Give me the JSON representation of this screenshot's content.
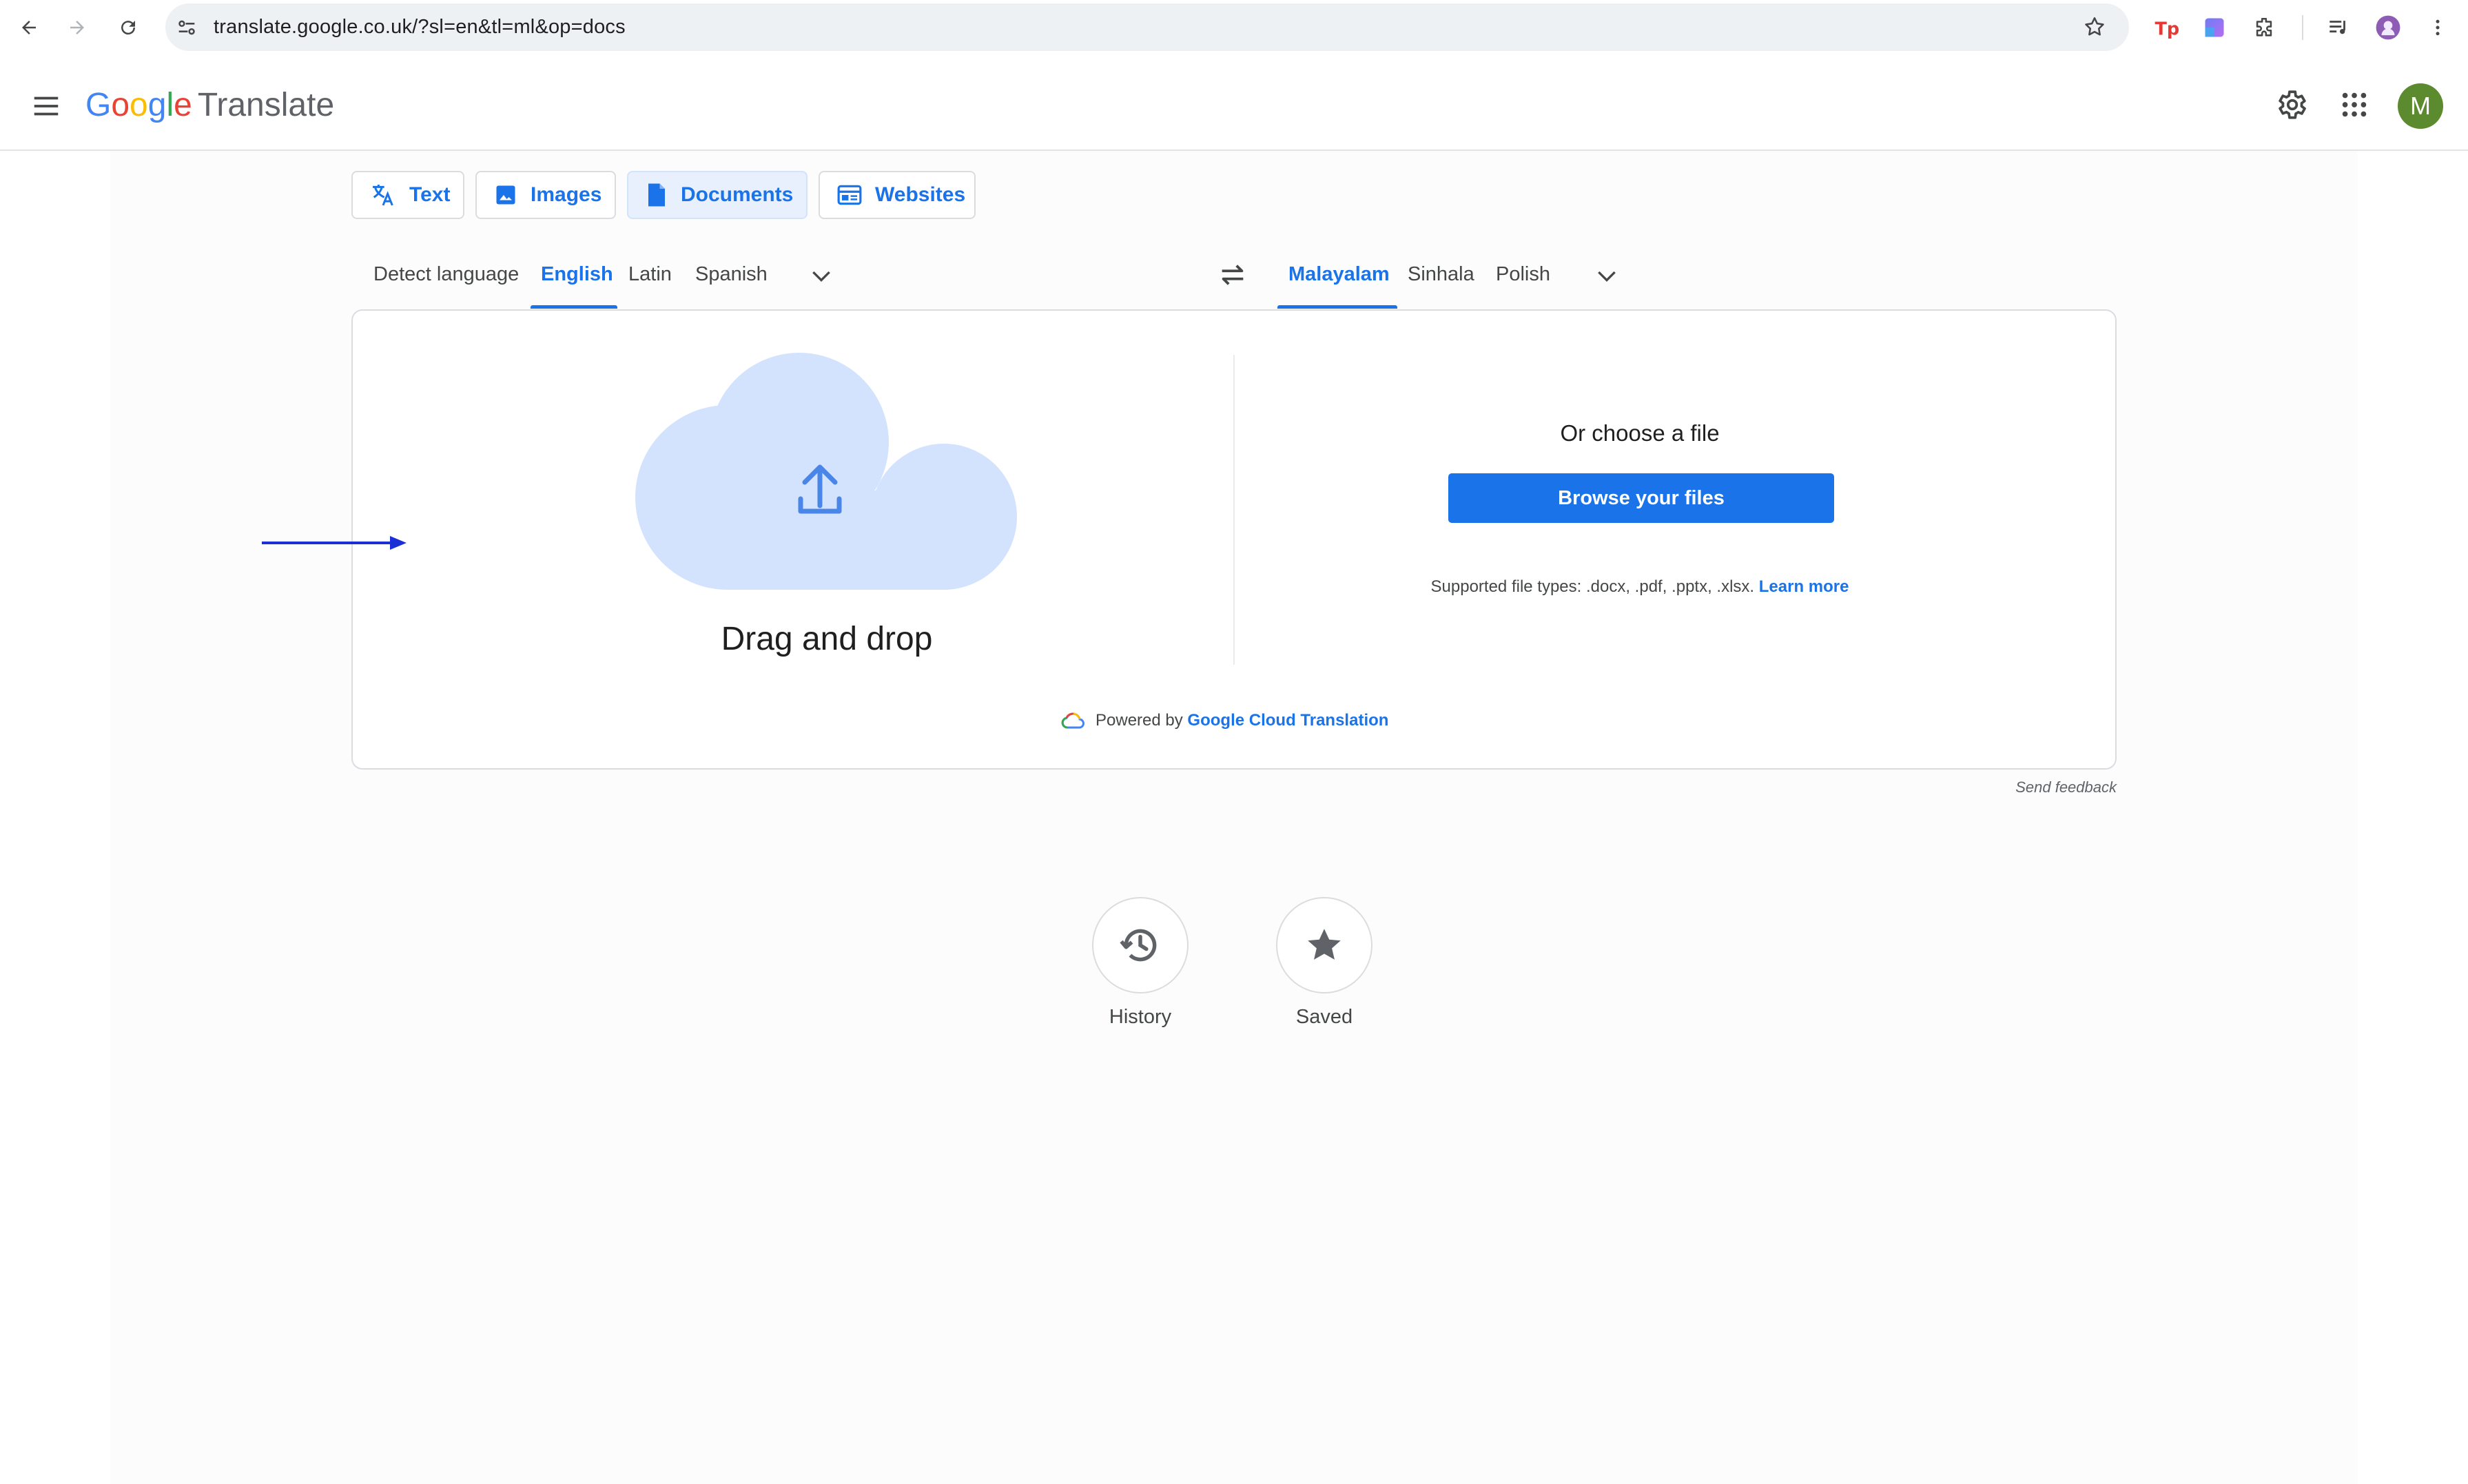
{
  "browser": {
    "url": "translate.google.co.uk/?sl=en&tl=ml&op=docs"
  },
  "app": {
    "logo_letters": [
      "G",
      "o",
      "o",
      "g",
      "l",
      "e"
    ],
    "product": "Translate",
    "avatar_initial": "M"
  },
  "modes": [
    {
      "label": "Text",
      "icon": "translate-icon"
    },
    {
      "label": "Images",
      "icon": "image-icon"
    },
    {
      "label": "Documents",
      "icon": "document-icon",
      "active": true
    },
    {
      "label": "Websites",
      "icon": "website-icon"
    }
  ],
  "source_languages": [
    "Detect language",
    "English",
    "Latin",
    "Spanish"
  ],
  "source_selected": "English",
  "target_languages": [
    "Malayalam",
    "Sinhala",
    "Polish"
  ],
  "target_selected": "Malayalam",
  "upload": {
    "drag_text": "Drag and drop",
    "choose_text": "Or choose a file",
    "browse_label": "Browse your files",
    "supported_text": "Supported file types: .docx, .pdf, .pptx, .xlsx.",
    "learn_more": "Learn more",
    "powered_by": "Powered by",
    "powered_link": "Google Cloud Translation"
  },
  "feedback": "Send feedback",
  "bottom": {
    "history": "History",
    "saved": "Saved"
  },
  "colors": {
    "accent": "#1a73e8",
    "cloud": "#d3e3fd",
    "annotation_arrow": "#1a2fd6",
    "avatar": "#5c8a2e"
  }
}
